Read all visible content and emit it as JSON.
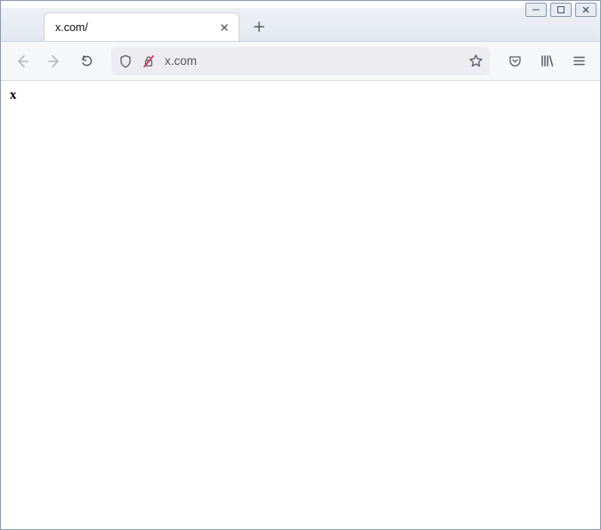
{
  "tab": {
    "title": "x.com/"
  },
  "urlbar": {
    "url": "x.com"
  },
  "page": {
    "body_text": "x"
  }
}
